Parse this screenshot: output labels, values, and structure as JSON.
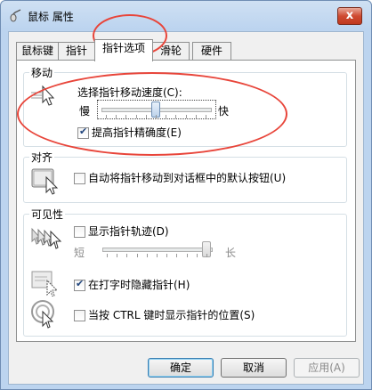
{
  "window": {
    "title": "鼠标 属性",
    "close_glyph": "x"
  },
  "tabs": [
    {
      "label": "鼠标键",
      "active": false
    },
    {
      "label": "指针",
      "active": false
    },
    {
      "label": "指针选项",
      "active": true
    },
    {
      "label": "滑轮",
      "active": false
    },
    {
      "label": "硬件",
      "active": false
    }
  ],
  "motion": {
    "group_title": "移动",
    "speed_label": "选择指针移动速度(C):",
    "slow_label": "慢",
    "fast_label": "快",
    "speed_level": 0.5,
    "precision_label": "提高指针精确度(E)",
    "precision_checked": true,
    "icon": "pointer-speed-icon"
  },
  "snap": {
    "group_title": "对齐",
    "snap_label": "自动将指针移动到对话框中的默认按钮(U)",
    "snap_checked": false,
    "icon": "snap-to-button-icon"
  },
  "visibility": {
    "group_title": "可见性",
    "trails_label": "显示指针轨迹(D)",
    "trails_checked": false,
    "short_label": "短",
    "long_label": "长",
    "trails_level": 1.0,
    "trails_icon": "pointer-trails-icon",
    "hide_label": "在打字时隐藏指针(H)",
    "hide_checked": true,
    "hide_icon": "hide-while-typing-icon",
    "ctrl_label": "当按 CTRL 键时显示指针的位置(S)",
    "ctrl_checked": false,
    "ctrl_icon": "ctrl-locate-icon"
  },
  "buttons": {
    "ok": "确定",
    "cancel": "取消",
    "apply": "应用(A)"
  },
  "colors": {
    "annotation": "#e8453a",
    "accent": "#3c7fb1"
  }
}
